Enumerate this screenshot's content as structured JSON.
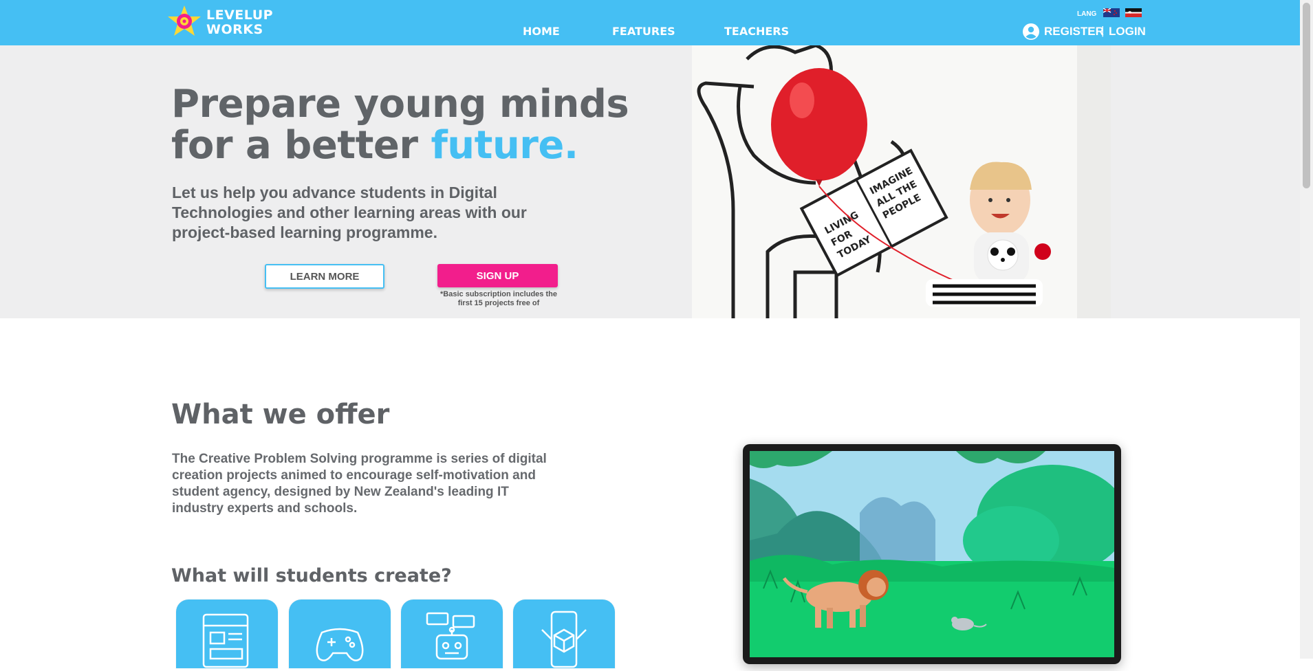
{
  "nav": {
    "logo_line1": "LEVELUP",
    "logo_line2": "WORKS",
    "links": [
      "HOME",
      "FEATURES",
      "TEACHERS"
    ],
    "lang_label": "LANG",
    "register": "REGISTER",
    "separator": "|",
    "login": "LOGIN"
  },
  "hero": {
    "title_line1": "Prepare young minds",
    "title_line2_pre": "for a better ",
    "title_accent": "future.",
    "subtitle": "Let us help you advance students in Digital Technologies and other learning areas with our project-based learning programme.",
    "learn_more": "LEARN MORE",
    "sign_up": "SIGN UP",
    "note": "*Basic subscription includes the first 15 projects free of",
    "book_text": "IMAGINE ALL THE PEOPLE LIVING FOR TODAY"
  },
  "offer": {
    "title": "What we offer",
    "text": "The Creative Problem Solving programme is series of digital creation projects animed to encourage self-motivation and student agency, designed by New Zealand's leading IT industry experts and schools.",
    "create_title": "What will students create?"
  },
  "tiles": [
    "website-icon",
    "gamepad-icon",
    "chatbot-icon",
    "augmented-reality-icon"
  ],
  "colors": {
    "primary": "#45bff3",
    "signup": "#f21e8c",
    "text": "#606468",
    "hero_bg": "#eeeeef"
  }
}
